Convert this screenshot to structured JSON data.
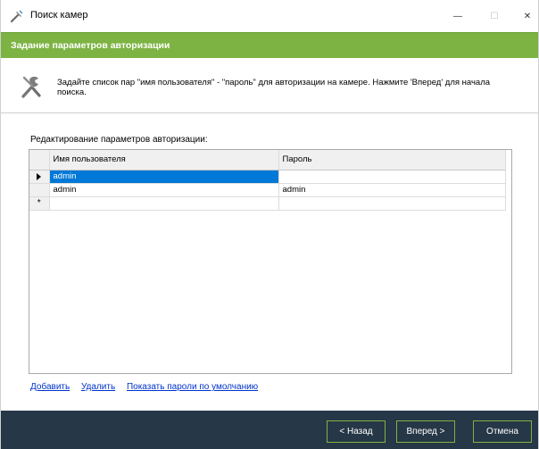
{
  "window": {
    "title": "Поиск камер",
    "min_glyph": "—",
    "max_glyph": "☐",
    "close_glyph": "✕"
  },
  "header": {
    "title": "Задание параметров авторизации"
  },
  "intro": {
    "text": "Задайте список пар \"имя пользователя\" - \"пароль\" для авторизации на камере. Нажмите 'Вперед' для начала поиска."
  },
  "section": {
    "label": "Редактирование параметров авторизации:"
  },
  "grid": {
    "columns": [
      "Имя пользователя",
      "Пароль"
    ],
    "rows": [
      {
        "indicator": "current",
        "username": "admin",
        "password": ""
      },
      {
        "indicator": "",
        "username": "admin",
        "password": "admin"
      },
      {
        "indicator": "new",
        "username": "",
        "password": ""
      }
    ],
    "new_row_glyph": "*"
  },
  "links": {
    "add": "Добавить",
    "delete": "Удалить",
    "show_defaults": "Показать пароли по умолчанию"
  },
  "footer": {
    "back": "< Назад",
    "next": "Вперед >",
    "cancel": "Отмена"
  },
  "colors": {
    "accent_green": "#7cb342",
    "footer_bg": "#263747",
    "selection": "#0078d7",
    "link": "#0033cc"
  }
}
